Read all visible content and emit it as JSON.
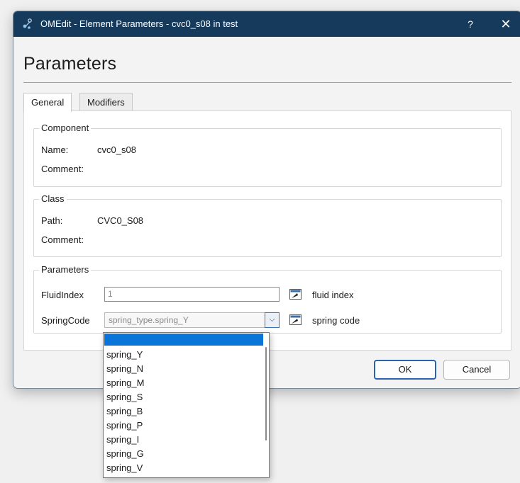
{
  "window": {
    "title": "OMEdit - Element Parameters - cvc0_s08 in test",
    "help_label": "?",
    "close_label": "✕"
  },
  "heading": "Parameters",
  "tabs": [
    {
      "label": "General",
      "active": true
    },
    {
      "label": "Modifiers",
      "active": false
    }
  ],
  "component": {
    "group_title": "Component",
    "name_label": "Name:",
    "name_value": "cvc0_s08",
    "comment_label": "Comment:",
    "comment_value": ""
  },
  "class": {
    "group_title": "Class",
    "path_label": "Path:",
    "path_value": "CVC0_S08",
    "comment_label": "Comment:",
    "comment_value": ""
  },
  "parameters": {
    "group_title": "Parameters",
    "fluid_index": {
      "label": "FluidIndex",
      "placeholder": "1",
      "description": "fluid index"
    },
    "spring_code": {
      "label": "SpringCode",
      "value": "spring_type.spring_Y",
      "description": "spring code"
    }
  },
  "buttons": {
    "ok": "OK",
    "cancel": "Cancel"
  },
  "dropdown": {
    "options": [
      "",
      "spring_Y",
      "spring_N",
      "spring_M",
      "spring_S",
      "spring_B",
      "spring_P",
      "spring_I",
      "spring_G",
      "spring_V"
    ],
    "highlighted_index": 0
  },
  "colors": {
    "titlebar": "#153a5b",
    "selection": "#0a74d8",
    "default_button_border": "#2a64b0"
  }
}
